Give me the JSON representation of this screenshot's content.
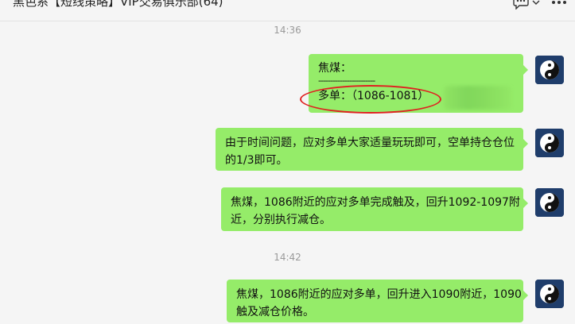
{
  "header": {
    "title": "黑色系【短线策略】VIP交易俱乐部(64)"
  },
  "messages": [
    {
      "timestamp": "14:36",
      "lines": [
        "焦煤：",
        "------------------------",
        "多单：（1086-1081）"
      ]
    },
    {
      "lines": [
        "由于时间问题，应对多单大家适量玩玩即可，空单持仓仓位",
        "的1/3即可。"
      ]
    },
    {
      "lines": [
        "焦煤，1086附近的应对多单完成触及，回升1092-1097附",
        "近，分别执行减仓。"
      ]
    },
    {
      "timestamp": "14:42",
      "lines": [
        "焦煤，1086附近的应对多单，回升进入1090附近，1090",
        "触及减仓价格。"
      ]
    }
  ],
  "icons": {
    "chat_more": "speech-bubble-icon",
    "dropdown": "chevron-down-icon",
    "menu": "ellipsis-icon",
    "avatar": "yin-yang-icon"
  },
  "colors": {
    "bubble": "#95ec69",
    "highlight_circle": "#e02020",
    "background": "#f5f5f5"
  }
}
